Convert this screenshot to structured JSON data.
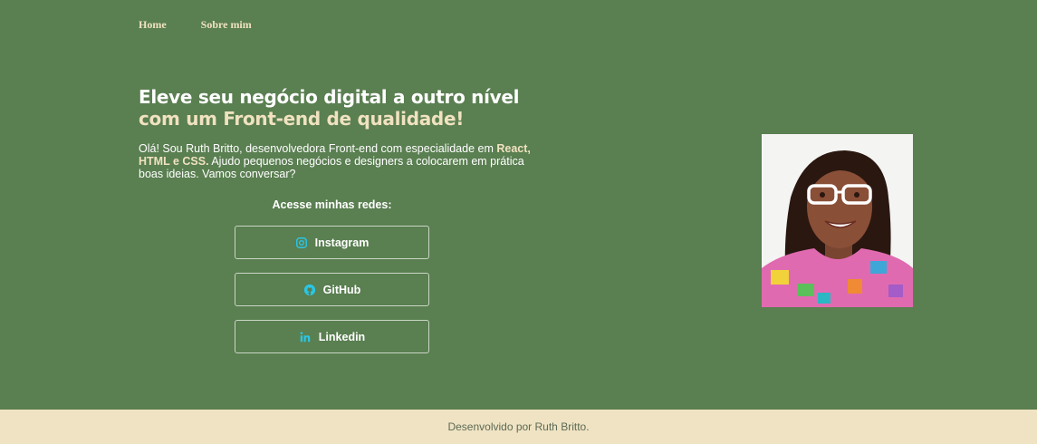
{
  "nav": {
    "items": [
      "Home",
      "Sobre mim"
    ]
  },
  "hero": {
    "title_line1": "Eleve seu negócio digital a outro nível",
    "title_line2": "com um Front-end de qualidade!",
    "intro_part1": "Olá! Sou Ruth Britto, desenvolvedora Front-end com especialidade em ",
    "intro_highlight": "React, HTML e CSS.",
    "intro_part2": " Ajudo pequenos negócios e designers a colocarem em prática boas ideias. Vamos conversar?"
  },
  "social": {
    "title": "Acesse minhas redes:",
    "links": [
      {
        "label": "Instagram",
        "icon": "instagram-icon"
      },
      {
        "label": "GitHub",
        "icon": "github-icon"
      },
      {
        "label": "Linkedin",
        "icon": "linkedin-icon"
      }
    ]
  },
  "colors": {
    "background": "#5a7f51",
    "accent": "#f0e2c0",
    "icon": "#29c6e6",
    "footer_bg": "#efe3c3"
  },
  "footer": {
    "text": "Desenvolvido por Ruth Britto."
  }
}
